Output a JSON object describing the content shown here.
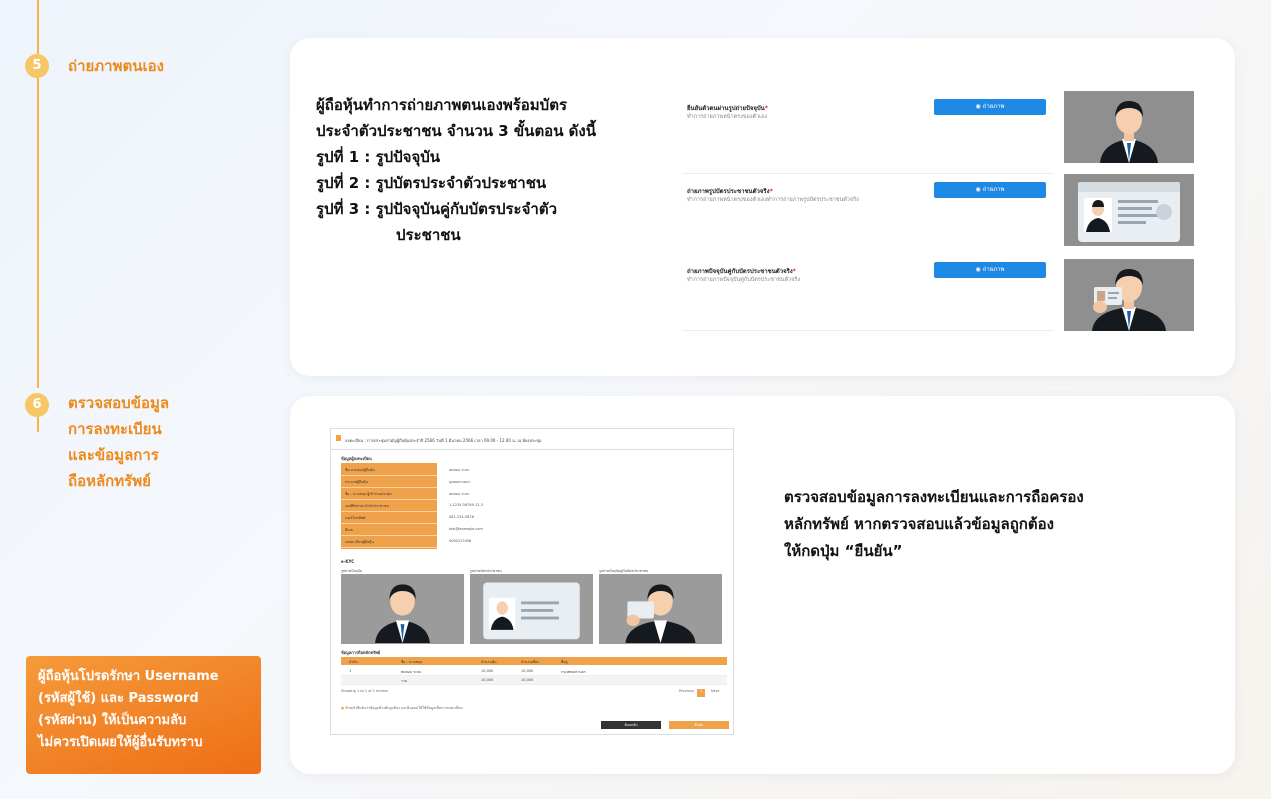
{
  "steps": [
    {
      "number": "5",
      "title": "ถ่ายภาพตนเอง"
    },
    {
      "number": "6",
      "title_lines": [
        "ตรวจสอบข้อมูล",
        "การลงทะเบียน",
        "และข้อมูลการ",
        "ถือหลักทรัพย์"
      ]
    }
  ],
  "step5": {
    "description_lines": [
      "ผู้ถือหุ้นทำการถ่ายภาพตนเองพร้อมบัตร",
      "ประจำตัวประชาชน จำนวน 3 ขั้นตอน ดังนี้",
      "รูปที่ 1 : รูปปัจจุบัน",
      "รูปที่ 2 : รูปบัตรประจำตัวประชาชน",
      "รูปที่ 3 : รูปปัจจุบันคู่กับบัตรประจำตัว",
      "ประชาชน"
    ],
    "form_rows": [
      {
        "label": "ยืนยันตัวตนผ่านรูปถ่ายปัจจุบัน",
        "required": "*",
        "hint": "ทำการถ่ายภาพหน้าตรงของตัวเอง",
        "button": "ถ่ายภาพ",
        "button_icon": "camera-icon",
        "photo": "man-portrait"
      },
      {
        "label": "ถ่ายภาพรูปบัตรประชาชนตัวจริง",
        "required": "*",
        "hint": "ทำการถ่ายภาพหน้าตรงของตัวเองทำการถ่ายภาพรูปบัตรประชาชนตัวจริง",
        "button": "ถ่ายภาพ",
        "button_icon": "camera-icon",
        "photo": "id-card"
      },
      {
        "label": "ถ่ายภาพปัจจุบันคู่กับบัตรประชาชนตัวจริง",
        "required": "*",
        "hint": "ทำการถ่ายภาพปัจจุบันคู่กับบัตรประชาชนตัวจริง",
        "button": "ถ่ายภาพ",
        "button_icon": "camera-icon",
        "photo": "man-with-card"
      }
    ]
  },
  "step6": {
    "description_lines": [
      "ตรวจสอบข้อมูลการลงทะเบียนและการถือครอง",
      "หลักทรัพย์ หากตรวจสอบแล้วข้อมูลถูกต้อง",
      "ให้กดปุ่ม “ยืนยัน”"
    ],
    "mini_screen": {
      "header": "ลงทะเบียน : การประชุมสามัญผู้ถือหุ้นประจำปี 2566 วันที่ 1 มีนาคม 2566 เวลา 09.00 - 12.00 น. ณ ห้องประชุม",
      "section_register": "ข้อมูลผู้ลงทะเบียน",
      "fields": [
        {
          "label": "ชื่อ-นามสกุลผู้ถือหุ้น",
          "value": "ทดสอบ ระบบ"
        },
        {
          "label": "ประเภทผู้ถือหุ้น",
          "value": "บุคคลธรรมดา"
        },
        {
          "label": "ชื่อ - นามสกุล ผู้เข้าร่วมประชุม",
          "value": "ทดสอบ ระบบ"
        },
        {
          "label": "เลขที่บัตรประจำตัวประชาชน",
          "value": "1-1234-56789-12-3"
        },
        {
          "label": "เบอร์โทรศัพท์",
          "value": "081-234-5678"
        },
        {
          "label": "อีเมล",
          "value": "test@example.com"
        },
        {
          "label": "เลขทะเบียนผู้ถือหุ้น",
          "value": "0000123456"
        }
      ],
      "section_ekyc": "e-KYC",
      "photo_labels": [
        "รูปถ่ายปัจจุบัน",
        "รูปถ่ายบัตรประชาชน",
        "รูปถ่ายปัจจุบันคู่กับบัตรประชาชน"
      ],
      "section_shares": "ข้อมูลการถือหลักทรัพย์",
      "table_headers": [
        "ลำดับ",
        "ชื่อ - นามสกุล",
        "จำนวนหุ้น",
        "จำนวนเสียง",
        "ที่อยู่"
      ],
      "table_rows": [
        [
          "1",
          "ทดสอบ ระบบ",
          "10,000",
          "10,000",
          "กรุงเทพมหานคร"
        ],
        [
          "",
          "รวม",
          "10,000",
          "10,000",
          ""
        ]
      ],
      "showing": "Showing 1 to 1 of 1 entries",
      "pagination": [
        "Previous",
        "1",
        "Next"
      ],
      "note": "ข้าพเจ้ายืนยันว่าข้อมูลข้างต้นถูกต้อง และยินยอมให้ใช้ข้อมูลเพื่อการลงทะเบียน",
      "back": "ย้อนกลับ",
      "confirm": "ยืนยัน"
    }
  },
  "notice_lines": [
    "ผู้ถือหุ้นโปรดรักษา Username",
    "(รหัสผู้ใช้) และ Password",
    "(รหัสผ่าน) ให้เป็นความลับ",
    "ไม่ควรเปิดเผยให้ผู้อื่นรับทราบ"
  ],
  "colors": {
    "accent_orange": "#ec8a1e",
    "step_circle": "#f6c667",
    "button_blue": "#1e88e5",
    "notice_bg": "#f07a20"
  }
}
